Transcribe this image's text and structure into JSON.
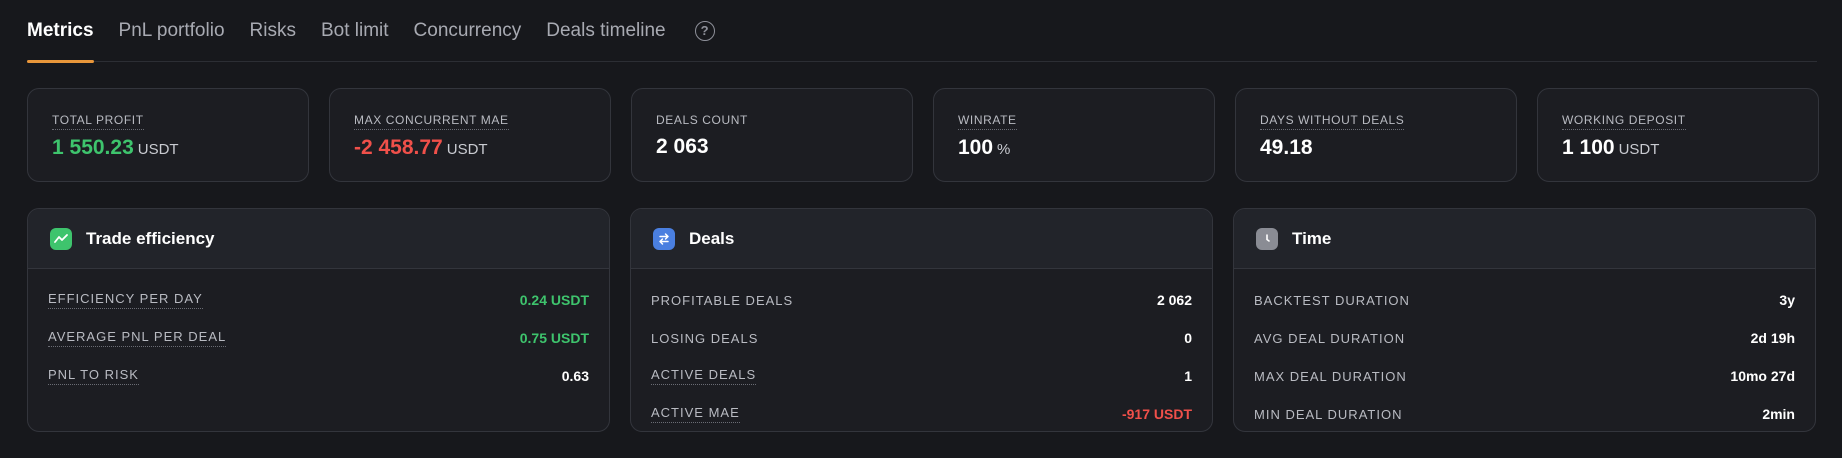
{
  "tabs": [
    "Metrics",
    "PnL portfolio",
    "Risks",
    "Bot limit",
    "Concurrency",
    "Deals timeline"
  ],
  "help_icon": "?",
  "stats": [
    {
      "label": "TOTAL PROFIT",
      "value": "1 550.23",
      "unit": "USDT",
      "color": "#3ec46d"
    },
    {
      "label": "MAX CONCURRENT MAE",
      "value": "-2 458.77",
      "unit": "USDT",
      "color": "#f0504a"
    },
    {
      "label": "DEALS COUNT",
      "value": "2 063",
      "unit": ""
    },
    {
      "label": "WINRATE",
      "value": "100",
      "unit": "%"
    },
    {
      "label": "DAYS WITHOUT DEALS",
      "value": "49.18",
      "unit": ""
    },
    {
      "label": "WORKING DEPOSIT",
      "value": "1 100",
      "unit": "USDT"
    }
  ],
  "trade_efficiency": {
    "title": "Trade efficiency",
    "icon": "trend-chart-icon",
    "rows": [
      {
        "label": "EFFICIENCY PER DAY",
        "value": "0.24 USDT"
      },
      {
        "label": "AVERAGE PNL PER DEAL",
        "value": "0.75 USDT"
      },
      {
        "label": "PNL TO RISK",
        "value": "0.63"
      }
    ]
  },
  "deals": {
    "title": "Deals",
    "icon": "swap-arrows-icon",
    "rows": [
      {
        "label": "PROFITABLE DEALS",
        "value": "2 062"
      },
      {
        "label": "LOSING DEALS",
        "value": "0"
      },
      {
        "label": "ACTIVE DEALS",
        "value": "1"
      },
      {
        "label": "ACTIVE MAE",
        "value": "-917 USDT"
      }
    ]
  },
  "time": {
    "title": "Time",
    "icon": "clock-icon",
    "rows": [
      {
        "label": "BACKTEST DURATION",
        "value": "3y"
      },
      {
        "label": "AVG DEAL DURATION",
        "value": "2d 19h"
      },
      {
        "label": "MAX DEAL DURATION",
        "value": "10mo 27d"
      },
      {
        "label": "MIN DEAL DURATION",
        "value": "2min"
      }
    ]
  },
  "colors": {
    "accent": "#e8963a",
    "positive": "#3ec46d",
    "negative": "#f0504a"
  }
}
